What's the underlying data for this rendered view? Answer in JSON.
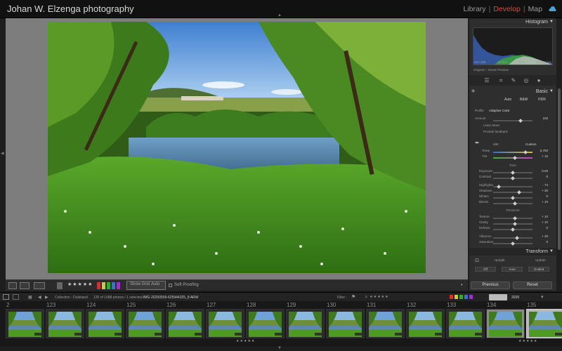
{
  "identity": {
    "studio_name": "Johan W. Elzenga photography"
  },
  "modules": {
    "library": "Library",
    "develop": "Develop",
    "map": "Map",
    "separator": "|"
  },
  "toolbar": {
    "show_grid_label": "Show Grid",
    "show_grid_value": "Auto",
    "soft_proofing_label": "Soft Proofing",
    "stars": "★★★★★"
  },
  "histogram": {
    "title": "Histogram",
    "iso": "ISO 200",
    "focal": "32 mm",
    "aperture": "f / 8",
    "shutter": "1/1000 sec",
    "preview_status": "Original + Smart Preview"
  },
  "basic": {
    "title": "Basic",
    "treatments": [
      "Auto",
      "B&W",
      "HDR"
    ],
    "profile_label": "Profile",
    "profile_value": "Adaptive Color",
    "amount_label": "Amount",
    "amount_value": "100",
    "learn_more": "Learn More",
    "provide_feedback": "Provide feedback",
    "wb_label": "WB :",
    "wb_value": "Custom",
    "temp_label": "Temp",
    "temp_value": "5,750",
    "tint_label": "Tint",
    "tint_value": "+ 15",
    "tone_label": "Tone",
    "exposure_label": "Exposure",
    "exposure_value": "0.00",
    "contrast_label": "Contrast",
    "contrast_value": "0",
    "highlights_label": "Highlights",
    "highlights_value": "- 74",
    "shadows_label": "Shadows",
    "shadows_value": "+ 30",
    "whites_label": "Whites",
    "whites_value": "0",
    "blacks_label": "Blacks",
    "blacks_value": "+ 10",
    "presence_label": "Presence",
    "texture_label": "Texture",
    "texture_value": "+ 10",
    "clarity_label": "Clarity",
    "clarity_value": "+ 10",
    "dehaze_label": "Dehaze",
    "dehaze_value": "0",
    "vibrance_label": "Vibrance",
    "vibrance_value": "+ 20",
    "saturation_label": "Saturation",
    "saturation_value": "0"
  },
  "transform": {
    "title": "Transform",
    "upright_label": "Upright",
    "update_label": "Update",
    "buttons": [
      "Off",
      "Auto",
      "Guided"
    ]
  },
  "panel_buttons": {
    "previous": "Previous",
    "reset": "Reset"
  },
  "filmstrip": {
    "source": "Collection : Duitsland",
    "count": "135 of 1088 photos / 1 selected /",
    "filename": "IMG-20250509-625944325_8 ARW",
    "filter_label": "Filter :",
    "year_value": "2025",
    "numbers": [
      "2",
      "123",
      "124",
      "125",
      "126",
      "127",
      "128",
      "129",
      "130",
      "131",
      "132",
      "133",
      "134",
      "135"
    ],
    "selected_rating": "★★★★★",
    "strip_rating": "★★★★★"
  }
}
